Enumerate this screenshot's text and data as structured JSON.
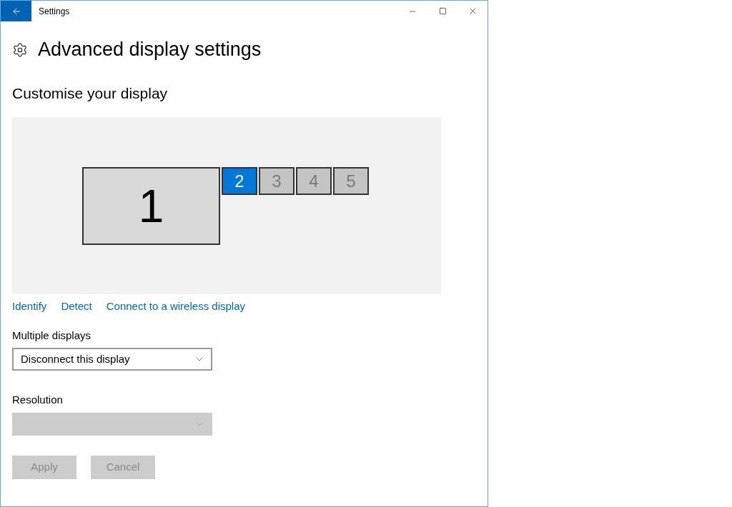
{
  "window": {
    "title": "Settings"
  },
  "header": {
    "title": "Advanced display settings"
  },
  "section_title": "Customise your display",
  "displays": [
    {
      "label": "1",
      "kind": "large",
      "selected": false,
      "active": true
    },
    {
      "label": "2",
      "kind": "small",
      "selected": true,
      "active": true
    },
    {
      "label": "3",
      "kind": "small",
      "selected": false,
      "active": false
    },
    {
      "label": "4",
      "kind": "small",
      "selected": false,
      "active": false
    },
    {
      "label": "5",
      "kind": "small",
      "selected": false,
      "active": false
    }
  ],
  "links": [
    "Identify",
    "Detect",
    "Connect to a wireless display"
  ],
  "multiple_displays": {
    "label": "Multiple displays",
    "value": "Disconnect this display",
    "disabled": false
  },
  "resolution": {
    "label": "Resolution",
    "disabled": true
  },
  "buttons": [
    {
      "label": "Apply",
      "disabled": true
    },
    {
      "label": "Cancel",
      "disabled": true
    }
  ]
}
